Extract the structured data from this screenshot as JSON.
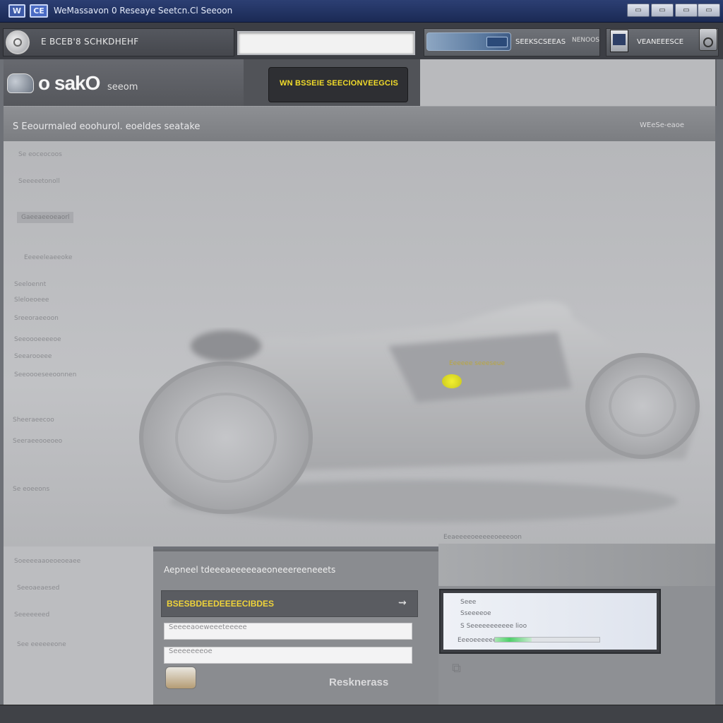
{
  "window": {
    "icon_a": "W",
    "icon_b": "CE",
    "title": "WeMassavon 0 Reseaye Seetcn.Cl Seeoon",
    "buttons": [
      "▭",
      "▭",
      "▭",
      "▭"
    ]
  },
  "toolbar": {
    "label": "E BCEB'8 SCHKDHEHF",
    "search_value": "",
    "scan_tab_label": "SEEKSCSEEAS",
    "scan_tab_sub": "NENOOS",
    "right_label": "VEANEEESCE"
  },
  "brand": {
    "name": "o sakO",
    "sub": "seeom",
    "start_button": "WN  BSSEIE SEECIONVEEGCIS",
    "right_faint": ""
  },
  "breadcrumb": {
    "text": "S Eeourmaled  eoohurol.  eoeldes  seatake",
    "right": "WEeSe-eaoe"
  },
  "sidebar": {
    "items": [
      "Se eoceocoos",
      "Seeeeetonoll",
      "Gaeeaeeoeaorl",
      "Eeeeeleaeeoke",
      "Seeloennt",
      "Sleloeoeee",
      "Sreeoraeeoon",
      "Seeoooeeeeoe",
      "Seearooeee",
      "Seeoooeseeoonnen",
      "Sheeraeecoo",
      "Seeraeeooeoeo",
      "Se eoeeons"
    ]
  },
  "illustration": {
    "caption": "Eeeeee   seeeseue"
  },
  "bottom_left": {
    "items": [
      "Soeeeeaaoeoeoeaee",
      "Seeoaeaesed",
      "Seeeeeeed",
      "See eeeeeeone"
    ]
  },
  "panel": {
    "title": "Aepneel  tdeeeaeeeeeaeoneeereeneeets",
    "bar_label": "BSESBDEEDEEEECIBDES",
    "bar_arrow": "⇝",
    "field1": "Seeeeaoeweeeteeeee",
    "field2": "Seeeeeeeoe",
    "foot": "Resknerass"
  },
  "right_block": {
    "caption": "Eeaeeeeoeeeeeoeeeoon",
    "preview_lines": [
      "Seee",
      "Sseeeeoe",
      "S  Seeeeeeeeeee   lioo",
      "Eeeoeeeeeeeseeeeeeee"
    ],
    "progress": 0.35
  },
  "colors": {
    "accent_yellow": "#f3dd2a",
    "titlebar": "#2c3f73",
    "panel": "#8a8c90"
  }
}
